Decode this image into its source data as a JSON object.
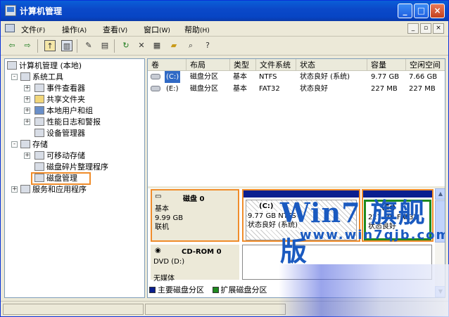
{
  "window": {
    "title": "计算机管理"
  },
  "menu": [
    {
      "label": "文件",
      "key": "(F)"
    },
    {
      "label": "操作",
      "key": "(A)"
    },
    {
      "label": "查看",
      "key": "(V)"
    },
    {
      "label": "窗口",
      "key": "(W)"
    },
    {
      "label": "帮助",
      "key": "(H)"
    }
  ],
  "mdi": {
    "min": "_",
    "restore": "▫",
    "close": "×"
  },
  "toolbar": [
    "back-icon",
    "forward-icon",
    "up-folder-icon",
    "show-tree-icon",
    "properties-icon",
    "export-icon",
    "refresh-icon",
    "delete-icon",
    "properties2-icon",
    "open-icon",
    "search-icon",
    "help-icon"
  ],
  "tree": {
    "root": "计算机管理 (本地)",
    "system_tools": "系统工具",
    "event_viewer": "事件查看器",
    "shared_folders": "共享文件夹",
    "local_users": "本地用户和组",
    "perf_logs": "性能日志和警报",
    "device_manager": "设备管理器",
    "storage": "存储",
    "removable": "可移动存储",
    "defrag": "磁盘碎片整理程序",
    "disk_mgmt": "磁盘管理",
    "services": "服务和应用程序",
    "plus": "+",
    "minus": "-"
  },
  "volumes": {
    "headers": [
      "卷",
      "布局",
      "类型",
      "文件系统",
      "状态",
      "容量",
      "空闲空间"
    ],
    "rows": [
      {
        "vol": "(C:)",
        "layout": "磁盘分区",
        "type": "基本",
        "fs": "NTFS",
        "status": "状态良好 (系统)",
        "capacity": "9.77 GB",
        "free": "7.66 GB"
      },
      {
        "vol": "(E:)",
        "layout": "磁盘分区",
        "type": "基本",
        "fs": "FAT32",
        "status": "状态良好",
        "capacity": "227 MB",
        "free": "227 MB"
      }
    ]
  },
  "watermark": {
    "brand": "Win7",
    "cn": "旗舰版",
    "url": "www.win7qjb.com"
  },
  "disk0": {
    "name": "磁盘 0",
    "type": "基本",
    "size": "9.99 GB",
    "state": "联机"
  },
  "part_c": {
    "name": "(C:)",
    "detail": "9.77 GB NTFS",
    "status": "状态良好 (系统)"
  },
  "part_e": {
    "name": "(E:)",
    "detail": "227 MB FAT32",
    "status": "状态良好"
  },
  "cdrom": {
    "name": "CD-ROM 0",
    "drive": "DVD (D:)",
    "media": "无媒体"
  },
  "legend": {
    "primary": "主要磁盘分区",
    "extended": "扩展磁盘分区"
  },
  "colors": {
    "primary": "#0a1f8f",
    "extended": "#1e8a1e",
    "highlight": "#f08c2a"
  }
}
